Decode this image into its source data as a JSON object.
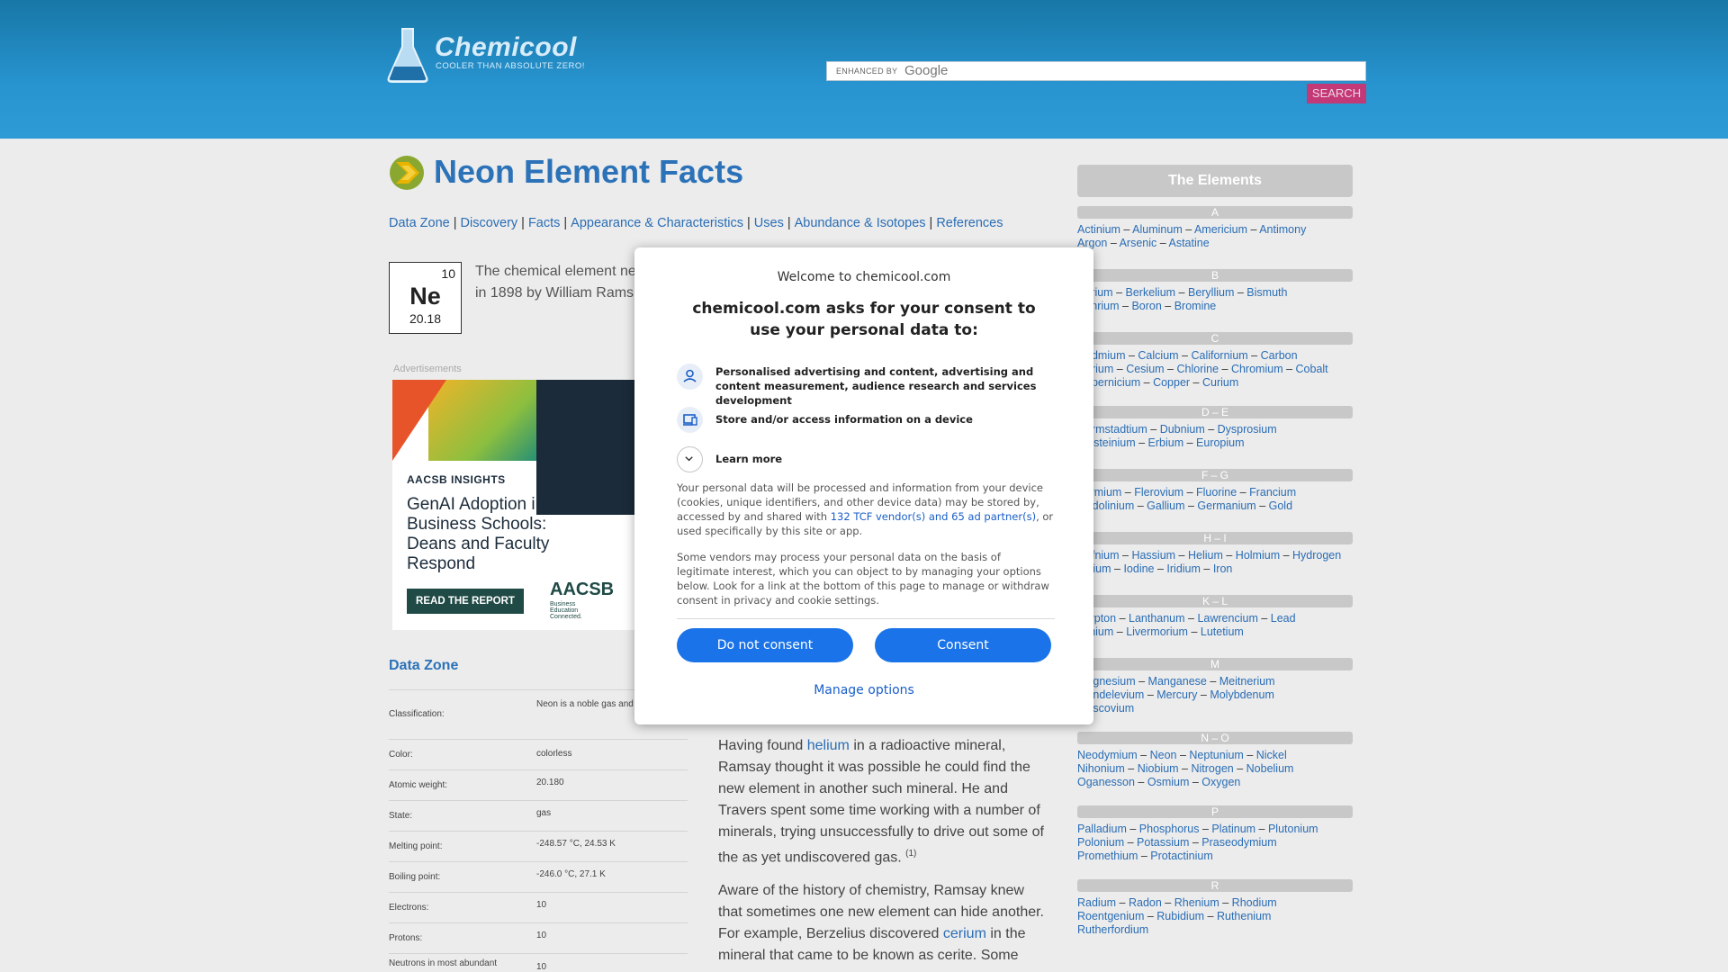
{
  "header": {
    "logo_text": "Chemicool",
    "logo_tagline": "COOLER THAN ABSOLUTE ZERO!",
    "search_enhanced": "ENHANCED BY",
    "search_google": "Google",
    "search_button": "SEARCH"
  },
  "page": {
    "title": "Neon Element Facts",
    "subnav": [
      "Data Zone",
      "Discovery",
      "Facts",
      "Appearance & Characteristics",
      "Uses",
      "Abundance & Isotopes",
      "References"
    ],
    "element": {
      "number": "10",
      "symbol": "Ne",
      "weight": "20.18"
    },
    "intro_line1": "The chemical element ne",
    "intro_line2": "in 1898 by William Rams"
  },
  "ad": {
    "label": "Advertisements",
    "brand": "AACSB INSIGHTS",
    "headline": "GenAI Adoption in Business Schools: Deans and Faculty Respond",
    "cta": "READ THE REPORT",
    "logo": "AACSB",
    "logo_sub": "Business Education Connected."
  },
  "data_zone": {
    "title": "Data Zone",
    "rows": [
      {
        "label": "Classification:",
        "value": "Neon is a noble gas and a nonmetal"
      },
      {
        "label": "Color:",
        "value": "colorless"
      },
      {
        "label": "Atomic weight:",
        "value": "20.180"
      },
      {
        "label": "State:",
        "value": "gas"
      },
      {
        "label": "Melting point:",
        "value": "-248.57 °C, 24.53 K"
      },
      {
        "label": "Boiling point:",
        "value": "-246.0 °C, 27.1 K"
      },
      {
        "label": "Electrons:",
        "value": "10"
      },
      {
        "label": "Protons:",
        "value": "10"
      },
      {
        "label": "Neutrons in most abundant",
        "value": "10"
      }
    ]
  },
  "body": {
    "p1_a": "Having found ",
    "p1_link": "helium",
    "p1_b": " in a radioactive mineral, Ramsay thought it was possible he could find the new element in another such mineral. He and Travers spent some time working with a number of minerals, trying unsuccessfully to drive out some of the as yet undiscovered gas.",
    "p1_ref": "(1)",
    "p2_a": "Aware of the history of chemistry, Ramsay knew that sometimes one new element can hide another. For example, Berzelius discovered ",
    "p2_link": "cerium",
    "p2_b": " in the mineral that came to be known as cerite. Some"
  },
  "sidebar": {
    "title": "The Elements",
    "groups": [
      {
        "letter": "A",
        "lines": [
          "Actinium – Aluminum – Americium – Antimony –",
          "Argon – Arsenic – Astatine"
        ]
      },
      {
        "letter": "B",
        "lines": [
          "Barium – Berkelium – Beryllium – Bismuth –",
          "Bohrium – Boron – Bromine"
        ]
      },
      {
        "letter": "C",
        "lines": [
          "Cadmium – Calcium – Californium – Carbon –",
          "Cerium – Cesium – Chlorine – Chromium – Cobalt –",
          "Copernicium – Copper – Curium"
        ]
      },
      {
        "letter": "D – E",
        "lines": [
          "Darmstadtium – Dubnium – Dysprosium –",
          "Einsteinium – Erbium – Europium"
        ]
      },
      {
        "letter": "F – G",
        "lines": [
          "Fermium – Flerovium – Fluorine – Francium –",
          "Gadolinium – Gallium – Germanium – Gold"
        ]
      },
      {
        "letter": "H – I",
        "lines": [
          "Hafnium – Hassium – Helium – Holmium – Hydrogen",
          "Indium – Iodine – Iridium – Iron"
        ]
      },
      {
        "letter": "K – L",
        "lines": [
          "Krypton – Lanthanum – Lawrencium – Lead –",
          "Lithium – Livermorium – Lutetium"
        ]
      },
      {
        "letter": "M",
        "lines": [
          "Magnesium – Manganese – Meitnerium –",
          "Mendelevium – Mercury – Molybdenum –",
          "Moscovium"
        ]
      },
      {
        "letter": "N – O",
        "lines": [
          "Neodymium – Neon – Neptunium – Nickel –",
          "Nihonium – Niobium – Nitrogen – Nobelium –",
          "Oganesson – Osmium – Oxygen"
        ]
      },
      {
        "letter": "P",
        "lines": [
          "Palladium – Phosphorus – Platinum – Plutonium –",
          "Polonium – Potassium – Praseodymium –",
          "Promethium – Protactinium"
        ]
      },
      {
        "letter": "R",
        "lines": [
          "Radium – Radon – Rhenium – Rhodium –",
          "Roentgenium – Rubidium – Ruthenium –",
          "Rutherfordium"
        ]
      }
    ]
  },
  "consent": {
    "welcome": "Welcome to chemicool.com",
    "title": "chemicool.com asks for your consent to use your personal data to:",
    "purpose1": "Personalised advertising and content, advertising and content measurement, audience research and services development",
    "purpose2": "Store and/or access information on a device",
    "learn_more": "Learn more",
    "para1_a": "Your personal data will be processed and information from your device (cookies, unique identifiers, and other device data) may be stored by, accessed by and shared with ",
    "para1_link": "132 TCF vendor(s) and 65 ad partner(s)",
    "para1_b": ", or used specifically by this site or app.",
    "para2": "Some vendors may process your personal data on the basis of legitimate interest, which you can object to by managing your options below. Look for a link at the bottom of this page to manage or withdraw consent in privacy and cookie settings.",
    "do_not_consent": "Do not consent",
    "consent": "Consent",
    "manage": "Manage options"
  },
  "colors": {
    "header_blue": "#2793cf",
    "link_blue": "#2a6db5",
    "button_blue": "#1a73e8",
    "search_pink": "#c33876"
  }
}
